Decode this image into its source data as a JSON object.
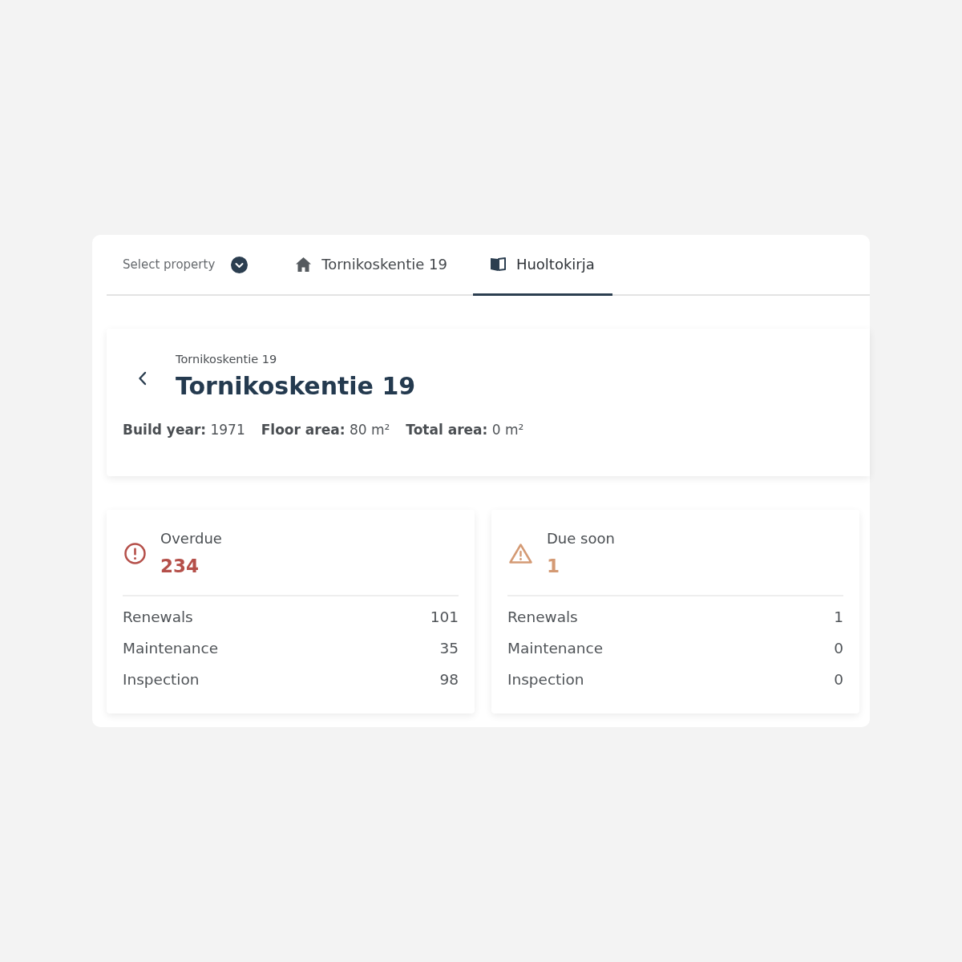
{
  "property_select": {
    "placeholder": "Select property"
  },
  "tabs": [
    {
      "kind": "property",
      "label": "Tornikoskentie 19",
      "selected": false
    },
    {
      "kind": "logbook",
      "label": "Huoltokirja",
      "selected": true
    }
  ],
  "header": {
    "breadcrumb": "Tornikoskentie 19",
    "title": "Tornikoskentie 19",
    "stats": [
      {
        "label": "Build year:",
        "value": "1971"
      },
      {
        "label": "Floor area:",
        "value": "80 m²"
      },
      {
        "label": "Total area:",
        "value": "0 m²"
      }
    ]
  },
  "summary": [
    {
      "kind": "overdue",
      "label": "Overdue",
      "count": "234",
      "color": "#b5504a",
      "rows": [
        {
          "label": "Renewals",
          "value": "101"
        },
        {
          "label": "Maintenance",
          "value": "35"
        },
        {
          "label": "Inspection",
          "value": "98"
        }
      ]
    },
    {
      "kind": "due_soon",
      "label": "Due soon",
      "count": "1",
      "color": "#d49a74",
      "rows": [
        {
          "label": "Renewals",
          "value": "1"
        },
        {
          "label": "Maintenance",
          "value": "0"
        },
        {
          "label": "Inspection",
          "value": "0"
        }
      ]
    }
  ]
}
